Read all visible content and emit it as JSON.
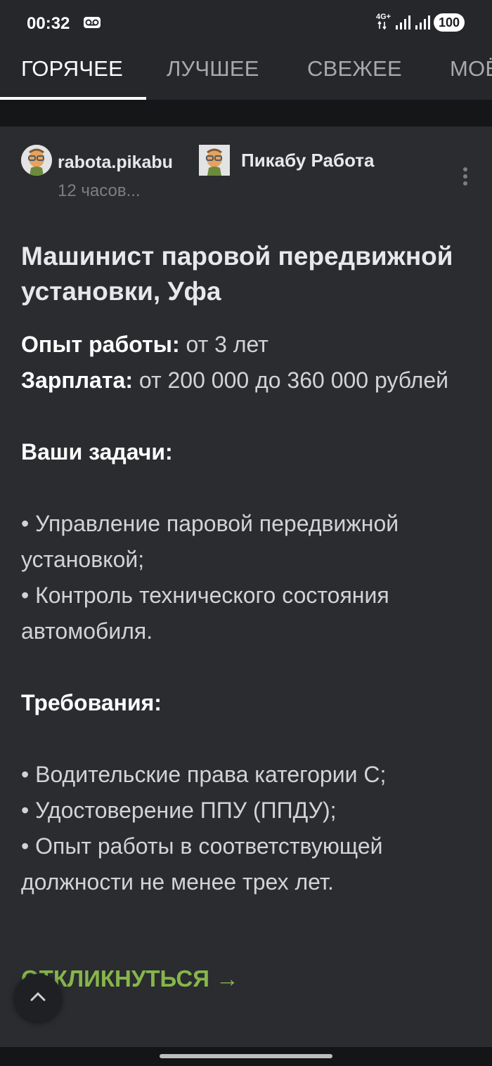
{
  "status_bar": {
    "time": "00:32",
    "network": "4G+",
    "battery": "100"
  },
  "tabs": [
    {
      "label": "ГОРЯЧЕЕ",
      "active": true
    },
    {
      "label": "ЛУЧШЕЕ",
      "active": false
    },
    {
      "label": "СВЕЖЕЕ",
      "active": false
    },
    {
      "label": "МОЁ",
      "active": false
    }
  ],
  "post": {
    "author": "rabota.pikabu",
    "time": "12 часов...",
    "community": "Пикабу Работа",
    "title": "Машинист паровой передвижной установки, Уфа",
    "experience_label": "Опыт работы:",
    "experience_value": " от 3 лет",
    "salary_label": "Зарплата:",
    "salary_value": " от 200 000 до 360 000 рублей",
    "tasks_heading": "Ваши задачи:",
    "tasks": [
      "• Управление паровой передвижной установкой;",
      "• Контроль технического состояния автомобиля."
    ],
    "requirements_heading": "Требования:",
    "requirements": [
      "• Водительские права категории С;",
      "• Удостоверение ППУ (ППДУ);",
      "• Опыт работы в соответствующей должности не менее трех лет."
    ],
    "apply_label": "ОТКЛИКНУТЬСЯ →"
  }
}
